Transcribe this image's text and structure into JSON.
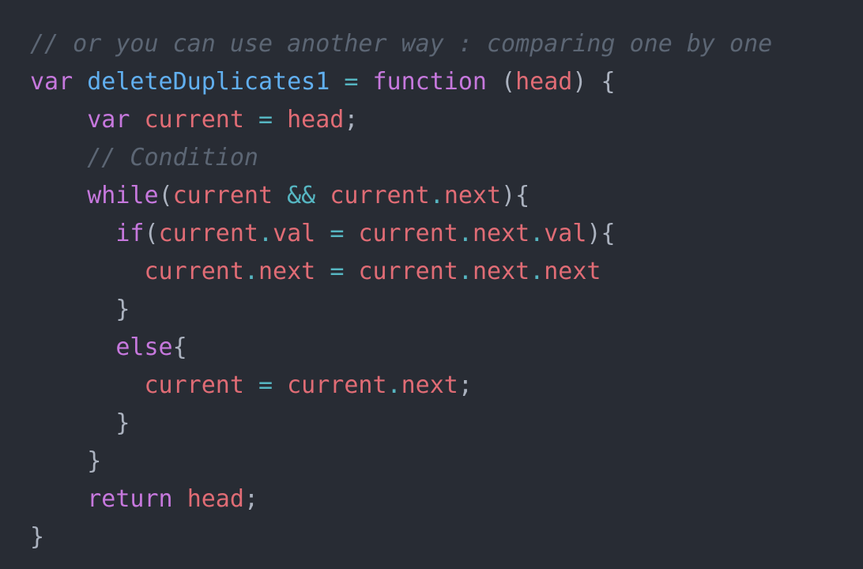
{
  "editor": {
    "background_color": "#282c34",
    "font_size_px": 30,
    "line_height_px": 48,
    "language": "javascript"
  },
  "colors": {
    "comment": "#5c6674",
    "keyword": "#c678dd",
    "function_name": "#61afef",
    "variable": "#e06c75",
    "operator": "#56b6c2",
    "punctuation": "#abb2bf"
  },
  "code": {
    "lines": [
      {
        "indent": "",
        "tokens": [
          {
            "text": "// or you can use another way : comparing one by one",
            "type": "comment"
          }
        ]
      },
      {
        "indent": "",
        "tokens": [
          {
            "text": "var",
            "type": "keyword"
          },
          {
            "text": " ",
            "type": "plain"
          },
          {
            "text": "deleteDuplicates1",
            "type": "func"
          },
          {
            "text": " ",
            "type": "plain"
          },
          {
            "text": "=",
            "type": "op"
          },
          {
            "text": " ",
            "type": "plain"
          },
          {
            "text": "function",
            "type": "keyword"
          },
          {
            "text": " ",
            "type": "plain"
          },
          {
            "text": "(",
            "type": "punct"
          },
          {
            "text": "head",
            "type": "var"
          },
          {
            "text": ")",
            "type": "punct"
          },
          {
            "text": " ",
            "type": "plain"
          },
          {
            "text": "{",
            "type": "punct"
          }
        ]
      },
      {
        "indent": "    ",
        "tokens": [
          {
            "text": "var",
            "type": "keyword"
          },
          {
            "text": " ",
            "type": "plain"
          },
          {
            "text": "current",
            "type": "var"
          },
          {
            "text": " ",
            "type": "plain"
          },
          {
            "text": "=",
            "type": "op"
          },
          {
            "text": " ",
            "type": "plain"
          },
          {
            "text": "head",
            "type": "var"
          },
          {
            "text": ";",
            "type": "punct"
          }
        ]
      },
      {
        "indent": "    ",
        "tokens": [
          {
            "text": "// Condition",
            "type": "comment"
          }
        ]
      },
      {
        "indent": "    ",
        "tokens": [
          {
            "text": "while",
            "type": "keyword"
          },
          {
            "text": "(",
            "type": "punct"
          },
          {
            "text": "current",
            "type": "var"
          },
          {
            "text": " ",
            "type": "plain"
          },
          {
            "text": "&&",
            "type": "op"
          },
          {
            "text": " ",
            "type": "plain"
          },
          {
            "text": "current",
            "type": "var"
          },
          {
            "text": ".",
            "type": "op"
          },
          {
            "text": "next",
            "type": "var"
          },
          {
            "text": ")",
            "type": "punct"
          },
          {
            "text": "{",
            "type": "punct"
          }
        ]
      },
      {
        "indent": "      ",
        "tokens": [
          {
            "text": "if",
            "type": "keyword"
          },
          {
            "text": "(",
            "type": "punct"
          },
          {
            "text": "current",
            "type": "var"
          },
          {
            "text": ".",
            "type": "op"
          },
          {
            "text": "val",
            "type": "var"
          },
          {
            "text": " ",
            "type": "plain"
          },
          {
            "text": "=",
            "type": "op"
          },
          {
            "text": " ",
            "type": "plain"
          },
          {
            "text": "current",
            "type": "var"
          },
          {
            "text": ".",
            "type": "op"
          },
          {
            "text": "next",
            "type": "var"
          },
          {
            "text": ".",
            "type": "op"
          },
          {
            "text": "val",
            "type": "var"
          },
          {
            "text": ")",
            "type": "punct"
          },
          {
            "text": "{",
            "type": "punct"
          }
        ]
      },
      {
        "indent": "        ",
        "tokens": [
          {
            "text": "current",
            "type": "var"
          },
          {
            "text": ".",
            "type": "op"
          },
          {
            "text": "next",
            "type": "var"
          },
          {
            "text": " ",
            "type": "plain"
          },
          {
            "text": "=",
            "type": "op"
          },
          {
            "text": " ",
            "type": "plain"
          },
          {
            "text": "current",
            "type": "var"
          },
          {
            "text": ".",
            "type": "op"
          },
          {
            "text": "next",
            "type": "var"
          },
          {
            "text": ".",
            "type": "op"
          },
          {
            "text": "next",
            "type": "var"
          }
        ]
      },
      {
        "indent": "      ",
        "tokens": [
          {
            "text": "}",
            "type": "punct"
          }
        ]
      },
      {
        "indent": "      ",
        "tokens": [
          {
            "text": "else",
            "type": "keyword"
          },
          {
            "text": "{",
            "type": "punct"
          }
        ]
      },
      {
        "indent": "        ",
        "tokens": [
          {
            "text": "current",
            "type": "var"
          },
          {
            "text": " ",
            "type": "plain"
          },
          {
            "text": "=",
            "type": "op"
          },
          {
            "text": " ",
            "type": "plain"
          },
          {
            "text": "current",
            "type": "var"
          },
          {
            "text": ".",
            "type": "op"
          },
          {
            "text": "next",
            "type": "var"
          },
          {
            "text": ";",
            "type": "punct"
          }
        ]
      },
      {
        "indent": "      ",
        "tokens": [
          {
            "text": "}",
            "type": "punct"
          }
        ]
      },
      {
        "indent": "    ",
        "tokens": [
          {
            "text": "}",
            "type": "punct"
          }
        ]
      },
      {
        "indent": "    ",
        "tokens": [
          {
            "text": "return",
            "type": "keyword"
          },
          {
            "text": " ",
            "type": "plain"
          },
          {
            "text": "head",
            "type": "var"
          },
          {
            "text": ";",
            "type": "punct"
          }
        ]
      },
      {
        "indent": "",
        "tokens": [
          {
            "text": "}",
            "type": "punct"
          }
        ]
      }
    ]
  }
}
